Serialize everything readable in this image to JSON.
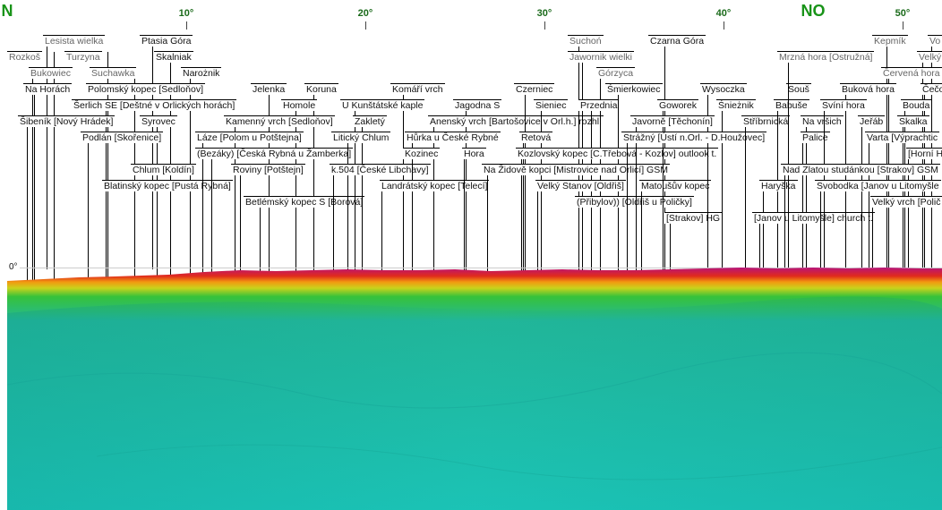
{
  "scale": {
    "degrees": [
      {
        "label": "10°",
        "pos": 10
      },
      {
        "label": "20°",
        "pos": 20
      },
      {
        "label": "30°",
        "pos": 30
      },
      {
        "label": "40°",
        "pos": 40
      },
      {
        "label": "50°",
        "pos": 50
      }
    ],
    "cardinals": [
      {
        "label": "N",
        "pos": 0
      },
      {
        "label": "NO",
        "pos": 45
      }
    ]
  },
  "horizon_label": "0°",
  "peaks": [
    {
      "name": "Rozkoš",
      "gray": true
    },
    {
      "name": "Lesista wielka",
      "gray": true
    },
    {
      "name": "Turzyna",
      "gray": true
    },
    {
      "name": "Ptasia Góra",
      "gray": false
    },
    {
      "name": "Skalniak",
      "gray": false
    },
    {
      "name": "Bukowiec",
      "gray": true
    },
    {
      "name": "Suchawka",
      "gray": true
    },
    {
      "name": "Narożnik",
      "gray": false
    },
    {
      "name": "Na Horách",
      "gray": false
    },
    {
      "name": "Polomský kopec [Sedloňov]",
      "gray": false
    },
    {
      "name": "Šerlich SE [Deštné v Orlických horách]",
      "gray": false
    },
    {
      "name": "Šibeník [Nový Hrádek]",
      "gray": false
    },
    {
      "name": "Syrovec",
      "gray": false
    },
    {
      "name": "Podlán [Skořenice]",
      "gray": false
    },
    {
      "name": "Chlum [Koldín]",
      "gray": false
    },
    {
      "name": "Blatinský kopec [Pustá Rybná]",
      "gray": false
    },
    {
      "name": "Jelenka",
      "gray": false
    },
    {
      "name": "Koruna",
      "gray": false
    },
    {
      "name": "Homole",
      "gray": false
    },
    {
      "name": "Kamenný vrch [Sedloňov]",
      "gray": false
    },
    {
      "name": "Láze [Polom u Potštejna]",
      "gray": false
    },
    {
      "name": "(Bezáky) [Česká Rybná u Žamberka]",
      "gray": false
    },
    {
      "name": "Roviny [Potštejn]",
      "gray": false
    },
    {
      "name": "Betlémský kopec S [Borová]",
      "gray": false
    },
    {
      "name": "Komáří vrch",
      "gray": false
    },
    {
      "name": "U Kunštátské kaple",
      "gray": false
    },
    {
      "name": "Zakletý",
      "gray": false
    },
    {
      "name": "Litický Chlum",
      "gray": false
    },
    {
      "name": "k.504 [České Libchavy]",
      "gray": false
    },
    {
      "name": "Jagodna S",
      "gray": false
    },
    {
      "name": "Anenský vrch [Bartošovice v Orl.h.] rozhl.",
      "gray": false
    },
    {
      "name": "Hůrka u České Rybné",
      "gray": false
    },
    {
      "name": "Kozinec",
      "gray": false
    },
    {
      "name": "Landrátský kopec [Telecí]",
      "gray": false
    },
    {
      "name": "Hora",
      "gray": false
    },
    {
      "name": "Czerniec",
      "gray": false
    },
    {
      "name": "Sieniec",
      "gray": false
    },
    {
      "name": "Retová",
      "gray": false
    },
    {
      "name": "Suchoń",
      "gray": true
    },
    {
      "name": "Jawornik wielki",
      "gray": true
    },
    {
      "name": "Górzyca",
      "gray": true
    },
    {
      "name": "Przednia",
      "gray": false
    },
    {
      "name": "Śmierkowiec",
      "gray": false
    },
    {
      "name": "Czarna Góra",
      "gray": false
    },
    {
      "name": "Kozlovský kopec [C.Třebová - Kozlov] outlook t.",
      "gray": false
    },
    {
      "name": "Na Židově kopci [Mistrovice nad Orlicí] GSM",
      "gray": false
    },
    {
      "name": "Velký Stanov [Oldřiš]",
      "gray": false
    },
    {
      "name": "(Přibylov)) [Oldřiš u Poličky]",
      "gray": false
    },
    {
      "name": "Matoušův kopec",
      "gray": false
    },
    {
      "name": "[Strakov] HG",
      "gray": false
    },
    {
      "name": "Wysoczka",
      "gray": false
    },
    {
      "name": "Goworek",
      "gray": false
    },
    {
      "name": "Śnieżnik",
      "gray": false
    },
    {
      "name": "Javorně [Těchonín]",
      "gray": false
    },
    {
      "name": "Strážný [Ústí n.Orl. - D.Houžovec]",
      "gray": false
    },
    {
      "name": "Stříbrnická",
      "gray": false
    },
    {
      "name": "Souš",
      "gray": false
    },
    {
      "name": "Babuše",
      "gray": false
    },
    {
      "name": "Na vršich",
      "gray": false
    },
    {
      "name": "Palice",
      "gray": false
    },
    {
      "name": "Haryška",
      "gray": false
    },
    {
      "name": "[Janov u Litomyšle] church t.",
      "gray": false
    },
    {
      "name": "Mrzná hora [Ostružná]",
      "gray": true
    },
    {
      "name": "Kepmík",
      "gray": true
    },
    {
      "name": "Vo",
      "gray": true
    },
    {
      "name": "Velký",
      "gray": true
    },
    {
      "name": "Červená hora",
      "gray": true
    },
    {
      "name": "Buková hora",
      "gray": false
    },
    {
      "name": "Čečo",
      "gray": false
    },
    {
      "name": "Svíní hora",
      "gray": false
    },
    {
      "name": "Bouda",
      "gray": false
    },
    {
      "name": "Jeřáb",
      "gray": false
    },
    {
      "name": "Skalka",
      "gray": false
    },
    {
      "name": "Varta [Výprachtic",
      "gray": false
    },
    {
      "name": "[Horní H",
      "gray": false
    },
    {
      "name": "Nad Zlatou studánkou [Strakov] GSM",
      "gray": false
    },
    {
      "name": "Svobodka [Janov u Litomyšle",
      "gray": false
    },
    {
      "name": "Velký vrch [Polič",
      "gray": false
    }
  ]
}
